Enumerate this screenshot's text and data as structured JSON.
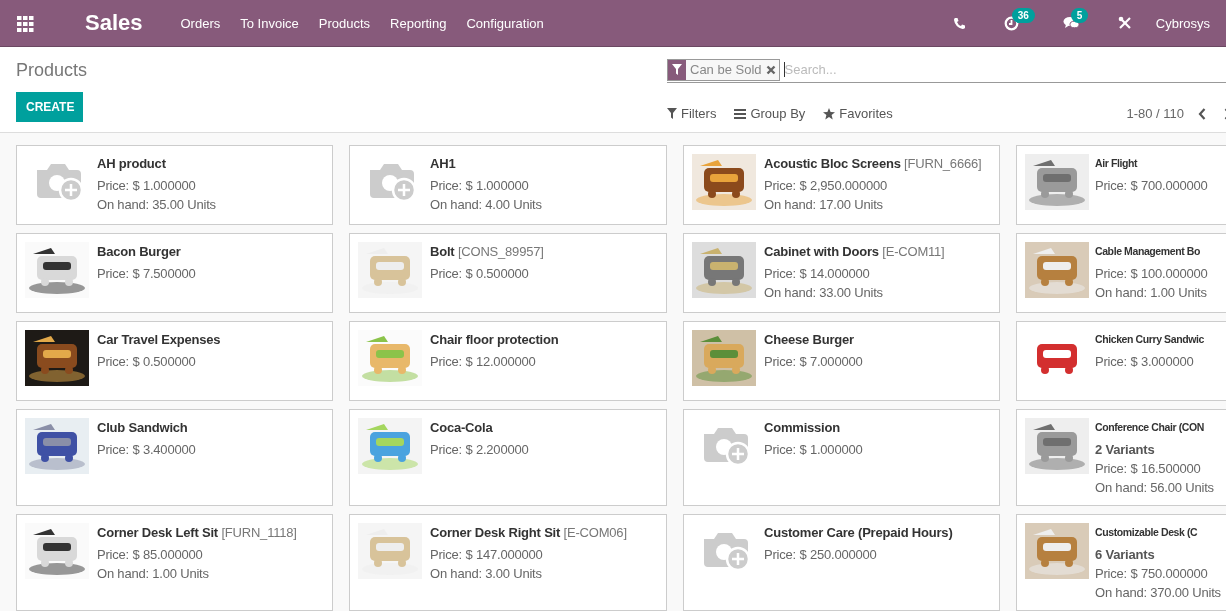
{
  "navbar": {
    "app": "Sales",
    "menu": [
      "Orders",
      "To Invoice",
      "Products",
      "Reporting",
      "Configuration"
    ],
    "activity_count": "36",
    "message_count": "5",
    "user": "Cybrosys"
  },
  "control_panel": {
    "breadcrumb": "Products",
    "create": "CREATE",
    "facet": "Can be Sold",
    "search": {
      "placeholder": "Search..."
    },
    "filters": "Filters",
    "group_by": "Group By",
    "favorites": "Favorites",
    "pager": "1-80 / 110"
  },
  "products": [
    {
      "name": "AH product",
      "price": "Price: $ 1.000000",
      "on_hand": "On hand: 35.00 Units",
      "kind": "placeholder"
    },
    {
      "name": "AH1",
      "price": "Price: $ 1.000000",
      "on_hand": "On hand: 4.00 Units",
      "kind": "placeholder"
    },
    {
      "name": "Acoustic Bloc Screens",
      "ref": "[FURN_6666]",
      "price": "Price: $ 2,950.000000",
      "on_hand": "On hand: 17.00 Units",
      "kind": "picture"
    },
    {
      "name": "Air Flight",
      "price": "Price: $ 700.000000",
      "kind": "picture"
    },
    {
      "name": "Bacon Burger",
      "price": "Price: $ 7.500000",
      "kind": "picture"
    },
    {
      "name": "Bolt",
      "ref": "[CONS_89957]",
      "price": "Price: $ 0.500000",
      "kind": "picture"
    },
    {
      "name": "Cabinet with Doors",
      "ref": "[E-COM11]",
      "price": "Price: $ 14.000000",
      "on_hand": "On hand: 33.00 Units",
      "kind": "picture"
    },
    {
      "name": "Cable Management Bo",
      "price": "Price: $ 100.000000",
      "on_hand": "On hand: 1.00 Units",
      "kind": "picture"
    },
    {
      "name": "Car Travel Expenses",
      "price": "Price: $ 0.500000",
      "kind": "picture"
    },
    {
      "name": "Chair floor protection",
      "price": "Price: $ 12.000000",
      "kind": "picture"
    },
    {
      "name": "Cheese Burger",
      "price": "Price: $ 7.000000",
      "kind": "picture"
    },
    {
      "name": "Chicken Curry Sandwic",
      "price": "Price: $ 3.000000",
      "kind": "picture"
    },
    {
      "name": "Club Sandwich",
      "price": "Price: $ 3.400000",
      "kind": "picture"
    },
    {
      "name": "Coca-Cola",
      "price": "Price: $ 2.200000",
      "kind": "picture"
    },
    {
      "name": "Commission",
      "price": "Price: $ 1.000000",
      "kind": "placeholder"
    },
    {
      "name": "Conference Chair (CON",
      "variants": "2 Variants",
      "price": "Price: $ 16.500000",
      "on_hand": "On hand: 56.00 Units",
      "kind": "picture"
    },
    {
      "name": "Corner Desk Left Sit",
      "ref": "[FURN_1118]",
      "price": "Price: $ 85.000000",
      "on_hand": "On hand: 1.00 Units",
      "kind": "picture"
    },
    {
      "name": "Corner Desk Right Sit",
      "ref": "[E-COM06]",
      "price": "Price: $ 147.000000",
      "on_hand": "On hand: 3.00 Units",
      "kind": "picture"
    },
    {
      "name": "Customer Care (Prepaid Hours)",
      "price": "Price: $ 250.000000",
      "kind": "placeholder"
    },
    {
      "name": "Customizable Desk (C",
      "variants": "6 Variants",
      "price": "Price: $ 750.000000",
      "on_hand": "On hand: 370.00 Units",
      "kind": "picture"
    }
  ]
}
